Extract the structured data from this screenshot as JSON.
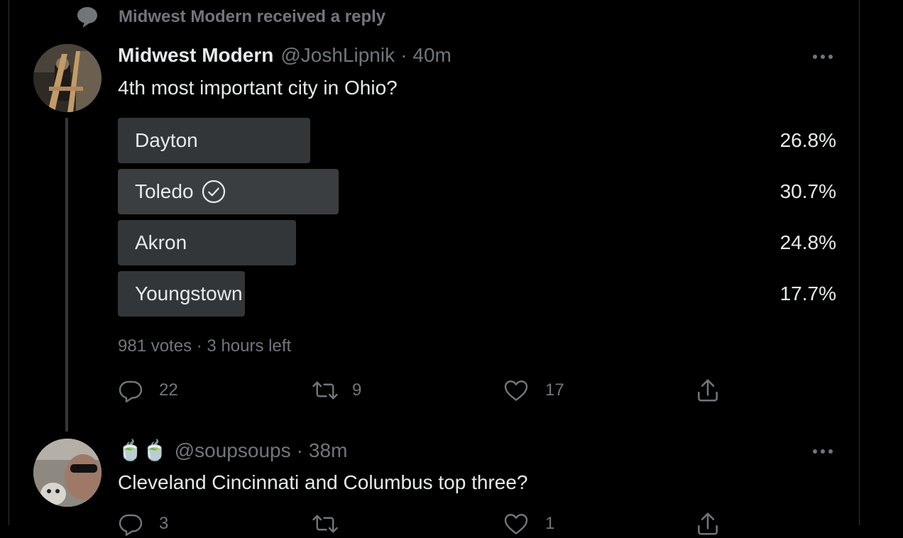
{
  "notification": {
    "text": "Midwest Modern received a reply",
    "icon": "speech-bubble-icon"
  },
  "tweet": {
    "name": "Midwest Modern",
    "handle": "@JoshLipnik",
    "sep": "·",
    "time": "40m",
    "text": "4th most important city in Ohio?",
    "poll": {
      "options": [
        {
          "label": "Dayton",
          "percent_text": "26.8%",
          "percent": 26.8,
          "winner": false
        },
        {
          "label": "Toledo",
          "percent_text": "30.7%",
          "percent": 30.7,
          "winner": true
        },
        {
          "label": "Akron",
          "percent_text": "24.8%",
          "percent": 24.8,
          "winner": false
        },
        {
          "label": "Youngstown",
          "percent_text": "17.7%",
          "percent": 17.7,
          "winner": false
        }
      ],
      "votes": "981 votes",
      "sep": "·",
      "time_left": "3 hours left"
    },
    "actions": {
      "replies": "22",
      "retweets": "9",
      "likes": "17"
    }
  },
  "reply": {
    "name_emoji": "🍵🍵",
    "handle": "@soupsoups",
    "sep": "·",
    "time": "38m",
    "text": "Cleveland Cincinnati and Columbus top three?",
    "actions": {
      "replies": "3",
      "retweets": "",
      "likes": "1"
    }
  },
  "colors": {
    "background": "#000000",
    "primary_text": "#e7e9ea",
    "secondary_text": "#71767b",
    "poll_bar": "#333639",
    "divider": "#2f3336"
  }
}
